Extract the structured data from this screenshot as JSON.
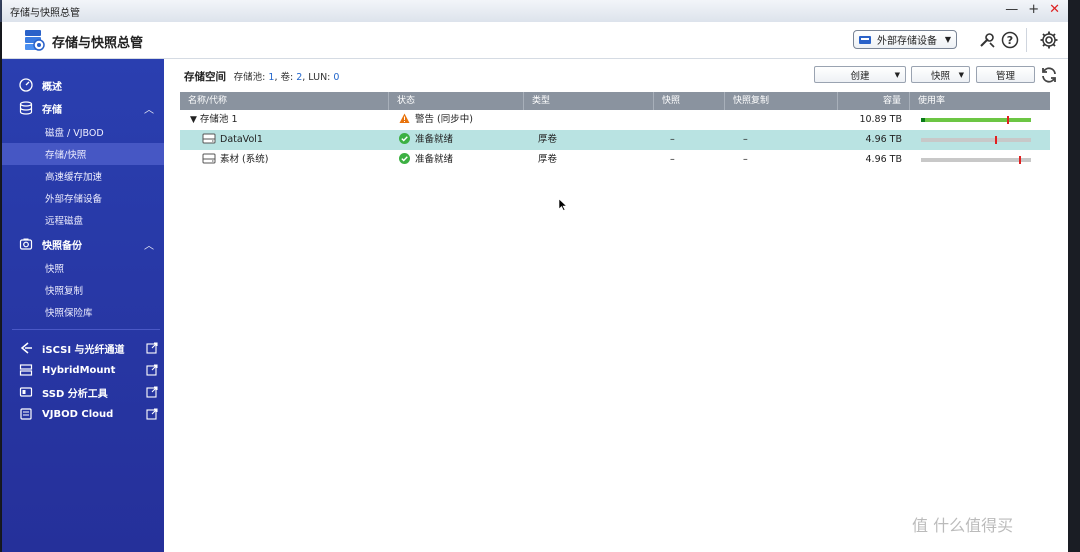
{
  "window": {
    "title": "存储与快照总管",
    "min": "—",
    "max": "+",
    "close": "✕"
  },
  "header": {
    "app_title": "存储与快照总管",
    "external_device_label": "外部存储设备"
  },
  "sidebar": {
    "overview": "概述",
    "storage": {
      "label": "存储",
      "items": [
        "磁盘 / VJBOD",
        "存储/快照",
        "高速缓存加速",
        "外部存储设备",
        "远程磁盘"
      ]
    },
    "snapshot_backup": {
      "label": "快照备份",
      "items": [
        "快照",
        "快照复制",
        "快照保险库"
      ]
    },
    "external_apps": [
      "iSCSI 与光纤通道",
      "HybridMount",
      "SSD 分析工具",
      "VJBOD Cloud"
    ]
  },
  "content": {
    "breadcrumb_title": "存储空间",
    "meta": {
      "pool_label": "存储池:",
      "pool_count": "1",
      "vol_label": ", 卷:",
      "vol_count": "2",
      "lun_label": ", LUN:",
      "lun_count": "0"
    },
    "toolbar": {
      "create": "创建",
      "snapshot": "快照",
      "manage": "管理"
    }
  },
  "table": {
    "headers": [
      "名称/代称",
      "状态",
      "类型",
      "快照",
      "快照复制",
      "容量",
      "使用率"
    ],
    "pool": {
      "name": "存储池 1",
      "status": "警告 (同步中)",
      "capacity": "10.89 TB",
      "usage_fraction": 0.02
    },
    "volumes": [
      {
        "name": "DataVol1",
        "status": "准备就绪",
        "type": "厚卷",
        "snapshot": "–",
        "snapshot_replica": "–",
        "capacity": "4.96 TB",
        "usage_fraction": 0.0
      },
      {
        "name": "素材 (系统)",
        "status": "准备就绪",
        "type": "厚卷",
        "snapshot": "–",
        "snapshot_replica": "–",
        "capacity": "4.96 TB",
        "usage_fraction": 0.0
      }
    ]
  },
  "colors": {
    "sidebar": "#2a3fb0",
    "selected_row": "#b9e3e2",
    "ok": "#3cb043",
    "warn": "#e8730c",
    "pool_bar": "#6cc644",
    "threshold": "#e02020"
  },
  "watermark": "值 什么值得买"
}
